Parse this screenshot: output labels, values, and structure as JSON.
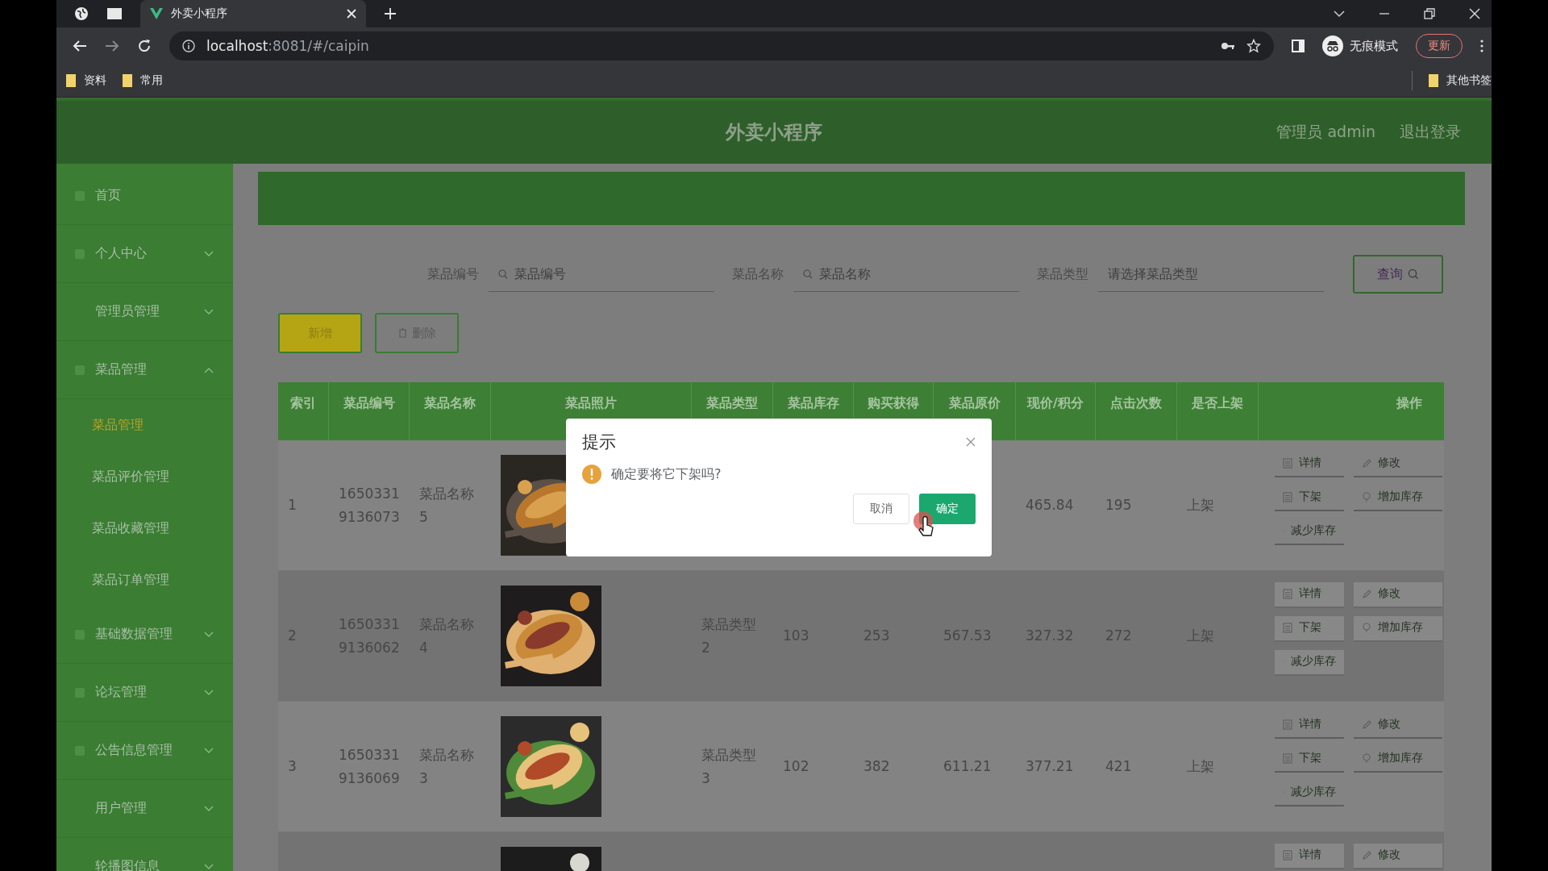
{
  "browser": {
    "tab_title": "外卖小程序",
    "url_host": "localhost",
    "url_path": ":8081/#/caipin",
    "incognito_label": "无痕模式",
    "update_label": "更新",
    "bookmarks": [
      "资料",
      "常用"
    ],
    "other_bookmarks": "其他书签"
  },
  "header": {
    "title": "外卖小程序",
    "user": "管理员 admin",
    "logout": "退出登录"
  },
  "sidebar": {
    "items": [
      {
        "label": "首页",
        "has_icon": true
      },
      {
        "label": "个人中心",
        "has_icon": true,
        "expanded": false
      },
      {
        "label": "管理员管理",
        "has_icon": false,
        "expanded": false
      },
      {
        "label": "菜品管理",
        "has_icon": true,
        "expanded": true,
        "children": [
          {
            "label": "菜品管理",
            "selected": true
          },
          {
            "label": "菜品评价管理",
            "selected": false
          },
          {
            "label": "菜品收藏管理",
            "selected": false
          },
          {
            "label": "菜品订单管理",
            "selected": false
          }
        ]
      },
      {
        "label": "基础数据管理",
        "has_icon": true,
        "expanded": false
      },
      {
        "label": "论坛管理",
        "has_icon": true,
        "expanded": false
      },
      {
        "label": "公告信息管理",
        "has_icon": true,
        "expanded": false
      },
      {
        "label": "用户管理",
        "has_icon": false,
        "expanded": false
      },
      {
        "label": "轮播图信息",
        "has_icon": false,
        "expanded": false
      }
    ]
  },
  "filters": [
    {
      "label": "菜品编号",
      "placeholder": "菜品编号",
      "kind": "search"
    },
    {
      "label": "菜品名称",
      "placeholder": "菜品名称",
      "kind": "search"
    },
    {
      "label": "菜品类型",
      "placeholder": "请选择菜品类型",
      "kind": "select"
    }
  ],
  "query_button": "查询",
  "toolbar": {
    "add": "新增",
    "delete": "删除"
  },
  "table": {
    "columns": [
      "索引",
      "菜品编号",
      "菜品名称",
      "菜品照片",
      "菜品类型",
      "菜品库存",
      "购买获得",
      "菜品原价",
      "现价/积分",
      "点击次数",
      "是否上架",
      "操作"
    ],
    "rows": [
      {
        "highlighted": false,
        "cells": [
          "1",
          "16503319136073",
          "菜品名称5",
          null,
          null,
          null,
          null,
          null,
          "465.84",
          "195",
          "上架"
        ],
        "photo": {
          "kind": "picture"
        },
        "actions": [
          {
            "label": "详情",
            "kind": "doc"
          },
          {
            "label": "修改",
            "kind": "edit"
          },
          {
            "label": "下架",
            "kind": "doc"
          },
          {
            "label": "增加库存",
            "kind": "pin"
          },
          {
            "label": "减少库存",
            "kind": "pin"
          }
        ]
      },
      {
        "highlighted": true,
        "cells": [
          "2",
          "16503319136062",
          "菜品名称4",
          null,
          "菜品类型2",
          "103",
          "253",
          "567.53",
          "327.32",
          "272",
          "上架"
        ],
        "photo": {
          "kind": "picture"
        },
        "actions": [
          {
            "label": "详情",
            "kind": "doc"
          },
          {
            "label": "修改",
            "kind": "edit"
          },
          {
            "label": "下架",
            "kind": "doc"
          },
          {
            "label": "增加库存",
            "kind": "pin"
          },
          {
            "label": "减少库存",
            "kind": "pin"
          }
        ]
      },
      {
        "highlighted": false,
        "cells": [
          "3",
          "16503319136069",
          "菜品名称3",
          null,
          "菜品类型3",
          "102",
          "382",
          "611.21",
          "377.21",
          "421",
          "上架"
        ],
        "photo": {
          "kind": "picture"
        },
        "actions": [
          {
            "label": "详情",
            "kind": "doc"
          },
          {
            "label": "修改",
            "kind": "edit"
          },
          {
            "label": "下架",
            "kind": "doc"
          },
          {
            "label": "增加库存",
            "kind": "pin"
          },
          {
            "label": "减少库存",
            "kind": "pin"
          }
        ]
      },
      {
        "highlighted": true,
        "cells": [
          null,
          null,
          null,
          null,
          null,
          null,
          null,
          null,
          null,
          null,
          null
        ],
        "photo": {
          "kind": "picture"
        },
        "actions": [
          {
            "label": "详情",
            "kind": "doc"
          },
          {
            "label": "修改",
            "kind": "edit"
          }
        ]
      }
    ]
  },
  "dialog": {
    "title": "提示",
    "message": "确定要将它下架吗?",
    "cancel": "取消",
    "confirm": "确定"
  }
}
